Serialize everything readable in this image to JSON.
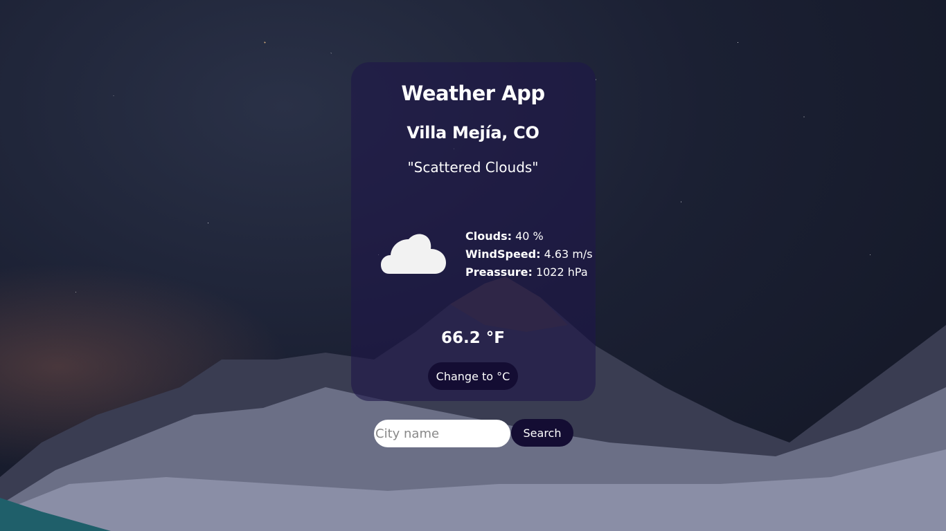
{
  "app": {
    "title": "Weather App"
  },
  "weather": {
    "location": "Villa Mejía, CO",
    "description": "\"Scattered Clouds\"",
    "icon": "cloud-icon",
    "temperature": "66.2 °F",
    "stats": [
      {
        "label": "Clouds:",
        "value": "40 %"
      },
      {
        "label": "WindSpeed:",
        "value": "4.63 m/s"
      },
      {
        "label": "Preassure:",
        "value": "1022 hPa"
      }
    ]
  },
  "controls": {
    "unit_toggle_label": "Change to °C",
    "search_placeholder": "City name",
    "search_value": "",
    "search_label": "Search"
  },
  "colors": {
    "card_background": "#1e1648",
    "button_background": "#140d33",
    "text": "#ffffff"
  }
}
